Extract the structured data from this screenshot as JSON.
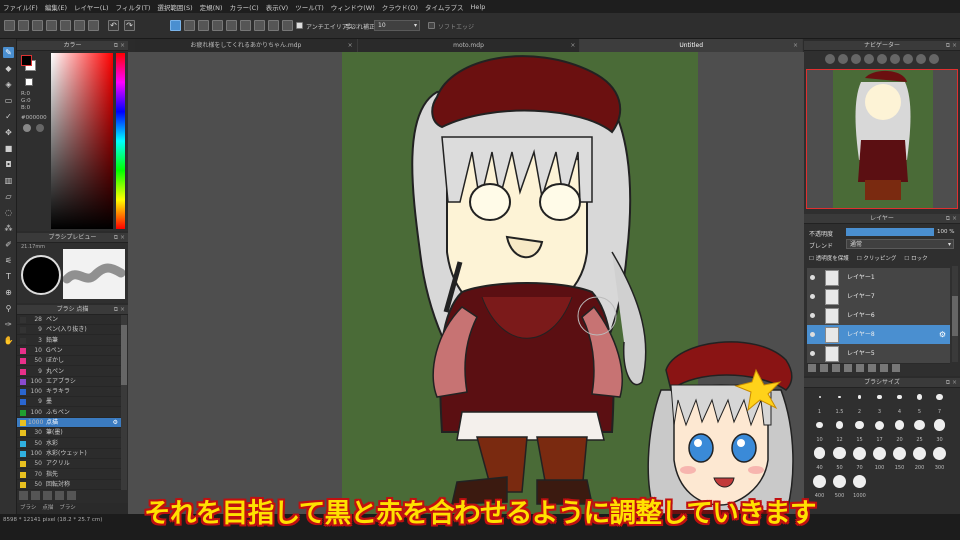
{
  "menubar": {
    "items": [
      "ファイル(F)",
      "編集(E)",
      "レイヤー(L)",
      "フィルタ(T)",
      "選択範囲(S)",
      "定規(N)",
      "カラー(C)",
      "表示(V)",
      "ツール(T)",
      "ウィンドウ(W)",
      "クラウド(O)",
      "タイムラプス",
      "Help"
    ]
  },
  "toolbar": {
    "antialias_label": "アンチエイリアス",
    "stabilizer_label": "手ぶれ補正",
    "stabilizer_value": "10",
    "softedge_label": "ソフトエッジ"
  },
  "tabs": [
    {
      "label": "お疲れ様をしてくれるあかりちゃん.mdp"
    },
    {
      "label": "moto.mdp"
    },
    {
      "label": "Untitled"
    }
  ],
  "panels": {
    "color_title": "カラー",
    "rgb": {
      "r": "R:0",
      "g": "G:0",
      "b": "B:0",
      "hex": "#000000"
    },
    "brush_preview_title": "ブラシプレビュー",
    "brush_preview_size": "21.17mm",
    "brush_list_title": "ブラシ  点描",
    "navigator_title": "ナビゲーター",
    "layer_title": "レイヤー",
    "opacity_label": "不透明度",
    "opacity_value": "100 %",
    "blend_label": "ブレンド",
    "blend_value": "通常",
    "protect_label": "透明度を保護",
    "clipping_label": "クリッピング",
    "lock_label": "ロック",
    "brush_size_title": "ブラシサイズ"
  },
  "brushes": [
    {
      "size": "28",
      "name": "ペン",
      "color": "#333333"
    },
    {
      "size": "9",
      "name": "ペン(入り抜き)",
      "color": "#333333"
    },
    {
      "size": "3",
      "name": "鉛筆",
      "color": "#333333"
    },
    {
      "size": "10",
      "name": "Gペン",
      "color": "#e8308a"
    },
    {
      "size": "50",
      "name": "ぼかし",
      "color": "#e8308a"
    },
    {
      "size": "9",
      "name": "丸ペン",
      "color": "#e8308a"
    },
    {
      "size": "100",
      "name": "エアブラシ",
      "color": "#8a4ad0"
    },
    {
      "size": "100",
      "name": "キラキラ",
      "color": "#2a66d0"
    },
    {
      "size": "9",
      "name": "墨",
      "color": "#2a66d0"
    },
    {
      "size": "100",
      "name": "ふちペン",
      "color": "#20a030"
    },
    {
      "size": "1000",
      "name": "点描",
      "color": "#e8c020",
      "selected": true
    },
    {
      "size": "30",
      "name": "筆(墨)",
      "color": "#e8c020"
    },
    {
      "size": "50",
      "name": "水彩",
      "color": "#30b0e0"
    },
    {
      "size": "100",
      "name": "水彩(ウェット)",
      "color": "#30b0e0"
    },
    {
      "size": "50",
      "name": "アクリル",
      "color": "#e8c020"
    },
    {
      "size": "70",
      "name": "指先",
      "color": "#e8c020"
    },
    {
      "size": "50",
      "name": "回転対称",
      "color": "#e8c020"
    }
  ],
  "left_footer": [
    "ブラシ",
    "点描",
    "ブラシ"
  ],
  "layers": [
    {
      "name": "レイヤー1"
    },
    {
      "name": "レイヤー7"
    },
    {
      "name": "レイヤー6"
    },
    {
      "name": "レイヤー8",
      "selected": true
    },
    {
      "name": "レイヤー5"
    }
  ],
  "brush_sizes": [
    "1",
    "1.5",
    "2",
    "3",
    "4",
    "5",
    "7",
    "10",
    "12",
    "15",
    "17",
    "20",
    "25",
    "30",
    "40",
    "50",
    "70",
    "100",
    "150",
    "200",
    "300",
    "400",
    "500",
    "1000"
  ],
  "status_text": "8598 * 12141 pixel  (18.2 * 25.7 cm)",
  "subtitle": "それを目指して黒と赤を合わせるように調整していきます"
}
